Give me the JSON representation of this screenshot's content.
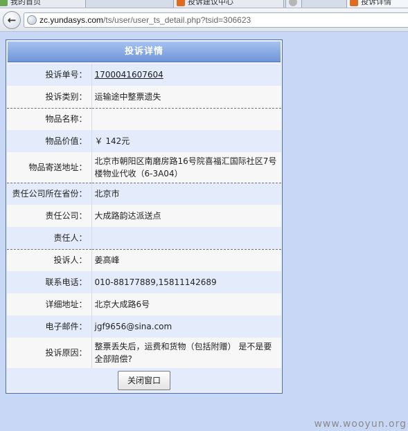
{
  "browser": {
    "tabs": [
      {
        "label": "我的首页",
        "icon": "page-icon",
        "color": "#6aa84f"
      },
      {
        "label": "投诉建议中心",
        "icon": "yunda-icon",
        "color": "#e06b1f"
      },
      {
        "label": "",
        "icon": "loading-icon",
        "color": "#b5b5b5"
      },
      {
        "label": "投诉详情",
        "icon": "yunda-icon",
        "color": "#e06b1f"
      }
    ],
    "url_domain": "zc.yundasys.com",
    "url_path": "/ts/user/user_ts_detail.php?tsid=306623"
  },
  "panel": {
    "title": "投诉详情"
  },
  "fields": {
    "ts_no_label": "投诉单号：",
    "ts_no_value": "1700041607604",
    "ts_type_label": "投诉类别：",
    "ts_type_value": "运输途中整票遗失",
    "item_name_label": "物品名称：",
    "item_name_value": "",
    "item_value_label": "物品价值：",
    "item_value_value": "￥ 142元",
    "ship_addr_label": "物品寄送地址：",
    "ship_addr_value": "北京市朝阳区南磨房路16号院喜福汇国际社区7号楼物业代收（6-3A04）",
    "province_label": "责任公司所在省份：",
    "province_value": "北京市",
    "company_label": "责任公司：",
    "company_value": "大成路韵达派送点",
    "person_label": "责任人：",
    "person_value": "",
    "complainant_label": "投诉人：",
    "complainant_value": "姜高峰",
    "phone_label": "联系电话：",
    "phone_value": "010-88177889,15811142689",
    "address_label": "详细地址：",
    "address_value": "北京大成路6号",
    "email_label": "电子邮件：",
    "email_value": "jgf9656@sina.com",
    "reason_label": "投诉原因：",
    "reason_value": "整票丢失后，运费和货物（包括附赠） 是不是要全部赔偿?"
  },
  "actions": {
    "close_label": "关闭窗口"
  },
  "watermark": "www.wooyun.org",
  "colors": {
    "page_bg": "#c9d7f7",
    "header_gradient_top": "#a6c2ef",
    "header_gradient_bottom": "#6f95d8",
    "row_odd": "#f7f7f7",
    "row_even": "#e4ecfb"
  }
}
